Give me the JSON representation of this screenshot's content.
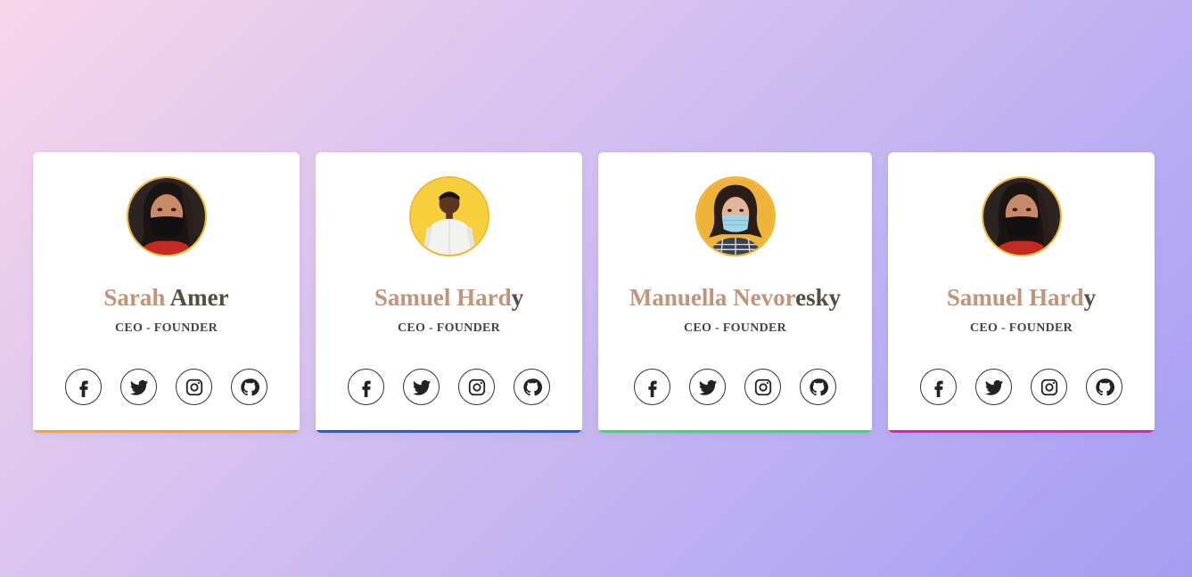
{
  "cards": [
    {
      "name": "Sarah Amer",
      "name_main": "Sarah",
      "name_rest": " Amer",
      "role": "CEO - FOUNDER",
      "accent": "#f5a623",
      "avatar_bg": "#3a2a28",
      "avatar_desc": "woman-black-mask"
    },
    {
      "name": "Samuel Hardy",
      "name_main": "Samuel Hard",
      "name_rest": "y",
      "role": "CEO - FOUNDER",
      "accent": "#1f5fd6",
      "avatar_bg": "#f7cf3d",
      "avatar_desc": "man-white-shirt"
    },
    {
      "name": "Manuella Nevoresky",
      "name_main": "Manuella Nevor",
      "name_rest": "esky",
      "role": "CEO - FOUNDER",
      "accent": "#2fe06a",
      "avatar_bg": "#f0b33a",
      "avatar_desc": "woman-blue-mask"
    },
    {
      "name": "Samuel Hardy",
      "name_main": "Samuel Hard",
      "name_rest": "y",
      "role": "CEO - FOUNDER",
      "accent": "#e21fb3",
      "avatar_bg": "#3a2a28",
      "avatar_desc": "woman-black-mask"
    }
  ],
  "social_icons": [
    "facebook-icon",
    "twitter-icon",
    "instagram-icon",
    "github-icon"
  ],
  "colors": {
    "background_start": "#f8d6ea",
    "background_end": "#a69cf2",
    "avatar_border": "#f2b52e",
    "name_color": "#c2947a"
  }
}
